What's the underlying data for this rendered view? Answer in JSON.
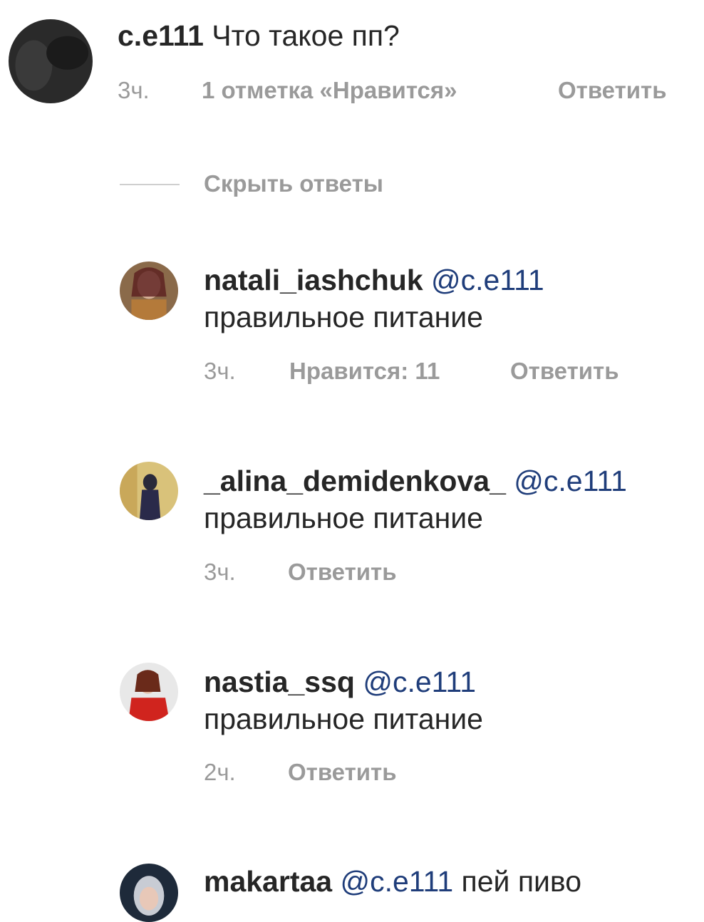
{
  "thread": {
    "comment": {
      "username": "c.e111",
      "text": "Что такое пп?",
      "time": "3ч.",
      "likes": "1 отметка «Нравится»",
      "reply": "Ответить"
    },
    "hide_replies": "Скрыть ответы",
    "replies": [
      {
        "username": "natali_iashchuk",
        "mention": "@c.e111",
        "text": "правильное питание",
        "time": "3ч.",
        "likes": "Нравится: 11",
        "reply": "Ответить"
      },
      {
        "username": "_alina_demidenkova_",
        "mention": "@c.e111",
        "text": "правильное питание",
        "time": "3ч.",
        "reply": "Ответить"
      },
      {
        "username": "nastia_ssq",
        "mention": "@c.e111",
        "text": "правильное питание",
        "time": "2ч.",
        "reply": "Ответить"
      },
      {
        "username": "makartaa",
        "mention": "@c.e111",
        "text": "пей пиво"
      }
    ]
  },
  "colors": {
    "text": "#262626",
    "secondary": "#9a9a9a",
    "mention": "#1f3d7a"
  }
}
